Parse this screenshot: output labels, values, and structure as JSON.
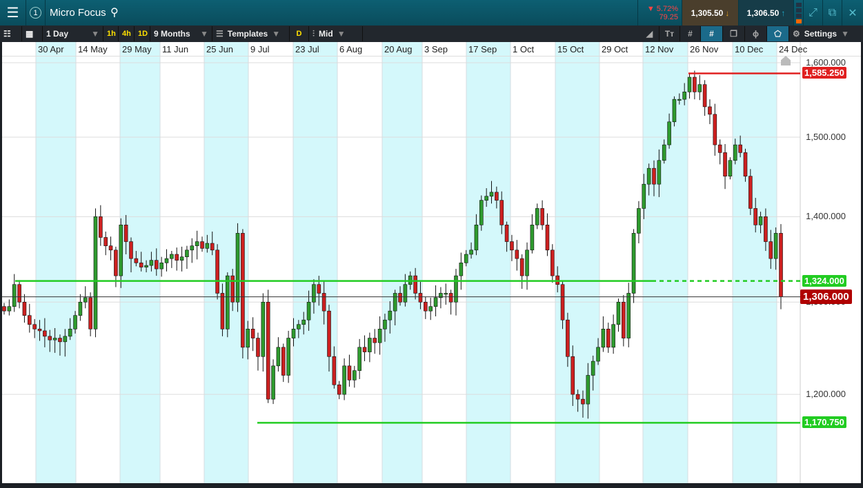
{
  "header": {
    "title": "Micro Focus",
    "change_pct": "5.72%",
    "change_abs": "79.25",
    "sell": "1,305.50",
    "buy": "1,306.50"
  },
  "toolbar": {
    "interval": "1 Day",
    "q1": "1h",
    "q2": "4h",
    "q3": "1D",
    "range": "9 Months",
    "templates": "Templates",
    "d": "D",
    "price_type": "Mid",
    "settings": "Settings"
  },
  "colors": {
    "up": "#2e9a2e",
    "down": "#cc2020",
    "band": "#d4f8fb",
    "line_green": "#22cc22",
    "line_red": "#e02020"
  },
  "chart_data": {
    "type": "candlestick",
    "scale": "log",
    "ylim": [
      1130,
      1625
    ],
    "x_tick_labels": [
      "30 Apr",
      "14 May",
      "29 May",
      "11 Jun",
      "25 Jun",
      "9 Jul",
      "23 Jul",
      "6 Aug",
      "20 Aug",
      "3 Sep",
      "17 Sep",
      "1 Oct",
      "15 Oct",
      "29 Oct",
      "12 Nov",
      "26 Nov",
      "10 Dec",
      "24 Dec"
    ],
    "y_ticks": [
      1200,
      1300,
      1400,
      1500,
      1600
    ],
    "y_tick_labels": [
      "1,200.000",
      "1,300.000",
      "1,400.000",
      "1,500.000",
      "1,600.000"
    ],
    "closes": [
      1290,
      1295,
      1320,
      1300,
      1285,
      1275,
      1270,
      1268,
      1262,
      1258,
      1260,
      1256,
      1262,
      1270,
      1285,
      1300,
      1305,
      1270,
      1400,
      1375,
      1365,
      1360,
      1330,
      1390,
      1370,
      1350,
      1345,
      1340,
      1342,
      1348,
      1338,
      1345,
      1350,
      1355,
      1348,
      1352,
      1360,
      1365,
      1370,
      1362,
      1368,
      1360,
      1310,
      1270,
      1330,
      1300,
      1380,
      1250,
      1270,
      1260,
      1240,
      1300,
      1195,
      1230,
      1250,
      1220,
      1260,
      1270,
      1275,
      1280,
      1300,
      1320,
      1310,
      1290,
      1240,
      1210,
      1200,
      1230,
      1215,
      1225,
      1250,
      1245,
      1260,
      1255,
      1270,
      1280,
      1290,
      1310,
      1300,
      1320,
      1330,
      1310,
      1300,
      1290,
      1295,
      1305,
      1310,
      1310,
      1300,
      1330,
      1345,
      1355,
      1360,
      1390,
      1420,
      1425,
      1430,
      1420,
      1390,
      1370,
      1360,
      1350,
      1330,
      1360,
      1390,
      1410,
      1390,
      1360,
      1330,
      1320,
      1280,
      1240,
      1200,
      1195,
      1190,
      1220,
      1235,
      1250,
      1270,
      1250,
      1275,
      1300,
      1260,
      1310,
      1380,
      1410,
      1440,
      1460,
      1440,
      1470,
      1490,
      1520,
      1550,
      1550,
      1560,
      1580,
      1560,
      1570,
      1540,
      1530,
      1490,
      1480,
      1450,
      1470,
      1490,
      1480,
      1450,
      1410,
      1390,
      1400,
      1370,
      1350,
      1380,
      1306
    ],
    "levels": [
      {
        "name": "resistance",
        "value": 1585.25,
        "label": "1,585.250",
        "color": "#e02020",
        "style": "solid"
      },
      {
        "name": "support-upper",
        "value": 1324,
        "label": "1,324.000",
        "color": "#22cc22",
        "style": "solid-then-dashed"
      },
      {
        "name": "support-lower",
        "value": 1170.75,
        "label": "1,170.750",
        "color": "#22cc22",
        "style": "solid"
      },
      {
        "name": "current-price",
        "value": 1306,
        "label": "1,306.000",
        "color": "#b00000",
        "style": "thin"
      }
    ]
  }
}
